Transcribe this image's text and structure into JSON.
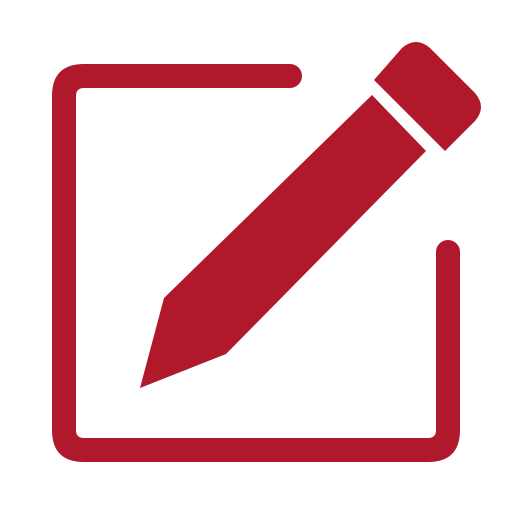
{
  "icon": {
    "name": "edit-icon",
    "color": "#B0182B",
    "background": "#FFFFFF"
  }
}
